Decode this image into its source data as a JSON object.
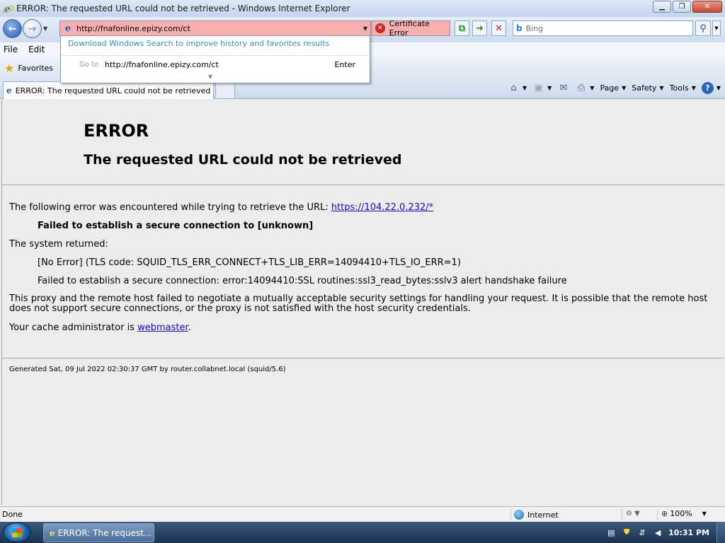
{
  "window": {
    "title": "ERROR: The requested URL could not be retrieved - Windows Internet Explorer"
  },
  "nav": {
    "address_url": "http://fnafonline.epizy.com/ct",
    "certificate_error": "Certificate Error",
    "search_placeholder": "Bing"
  },
  "address_dropdown": {
    "windows_search_link": "Download Windows Search to improve history and favorites results",
    "goto_label": "Go to",
    "goto_url": "http://fnafonline.epizy.com/ct",
    "enter_label": "Enter"
  },
  "menu": [
    "File",
    "Edit"
  ],
  "favorites": {
    "label": "Favorites"
  },
  "tab": {
    "title": "ERROR: The requested URL could not be retrieved"
  },
  "command_bar": {
    "page": "Page",
    "safety": "Safety",
    "tools": "Tools"
  },
  "page": {
    "heading": "ERROR",
    "subheading": "The requested URL could not be retrieved",
    "intro_text": "The following error was encountered while trying to retrieve the URL:",
    "intro_link": "https://104.22.0.232/*",
    "failed_bold": "Failed to establish a secure connection to [unknown]",
    "system_returned": "The system returned:",
    "tls_code": "[No Error] (TLS code: SQUID_TLS_ERR_CONNECT+TLS_LIB_ERR=14094410+TLS_IO_ERR=1)",
    "ssl_detail": "Failed to establish a secure connection: error:14094410:SSL routines:ssl3_read_bytes:sslv3 alert handshake failure",
    "explanation": "This proxy and the remote host failed to negotiate a mutually acceptable security settings for handling your request. It is possible that the remote host does not support secure connections, or the proxy is not satisfied with the host security credentials.",
    "admin_text": "Your cache administrator is",
    "admin_link": "webmaster",
    "admin_suffix": ".",
    "generated": "Generated Sat, 09 Jul 2022 02:30:37 GMT by router.collabnet.local (squid/5.6)"
  },
  "status": {
    "left": "Done",
    "zone": "Internet",
    "zoom": "100%"
  },
  "taskbar": {
    "task_label": "ERROR: The request...",
    "clock": "10:31 PM"
  },
  "colors": {
    "address_error_bg": "#f6b0b0",
    "link": "#1a0dab",
    "content_bg": "#ececec"
  }
}
